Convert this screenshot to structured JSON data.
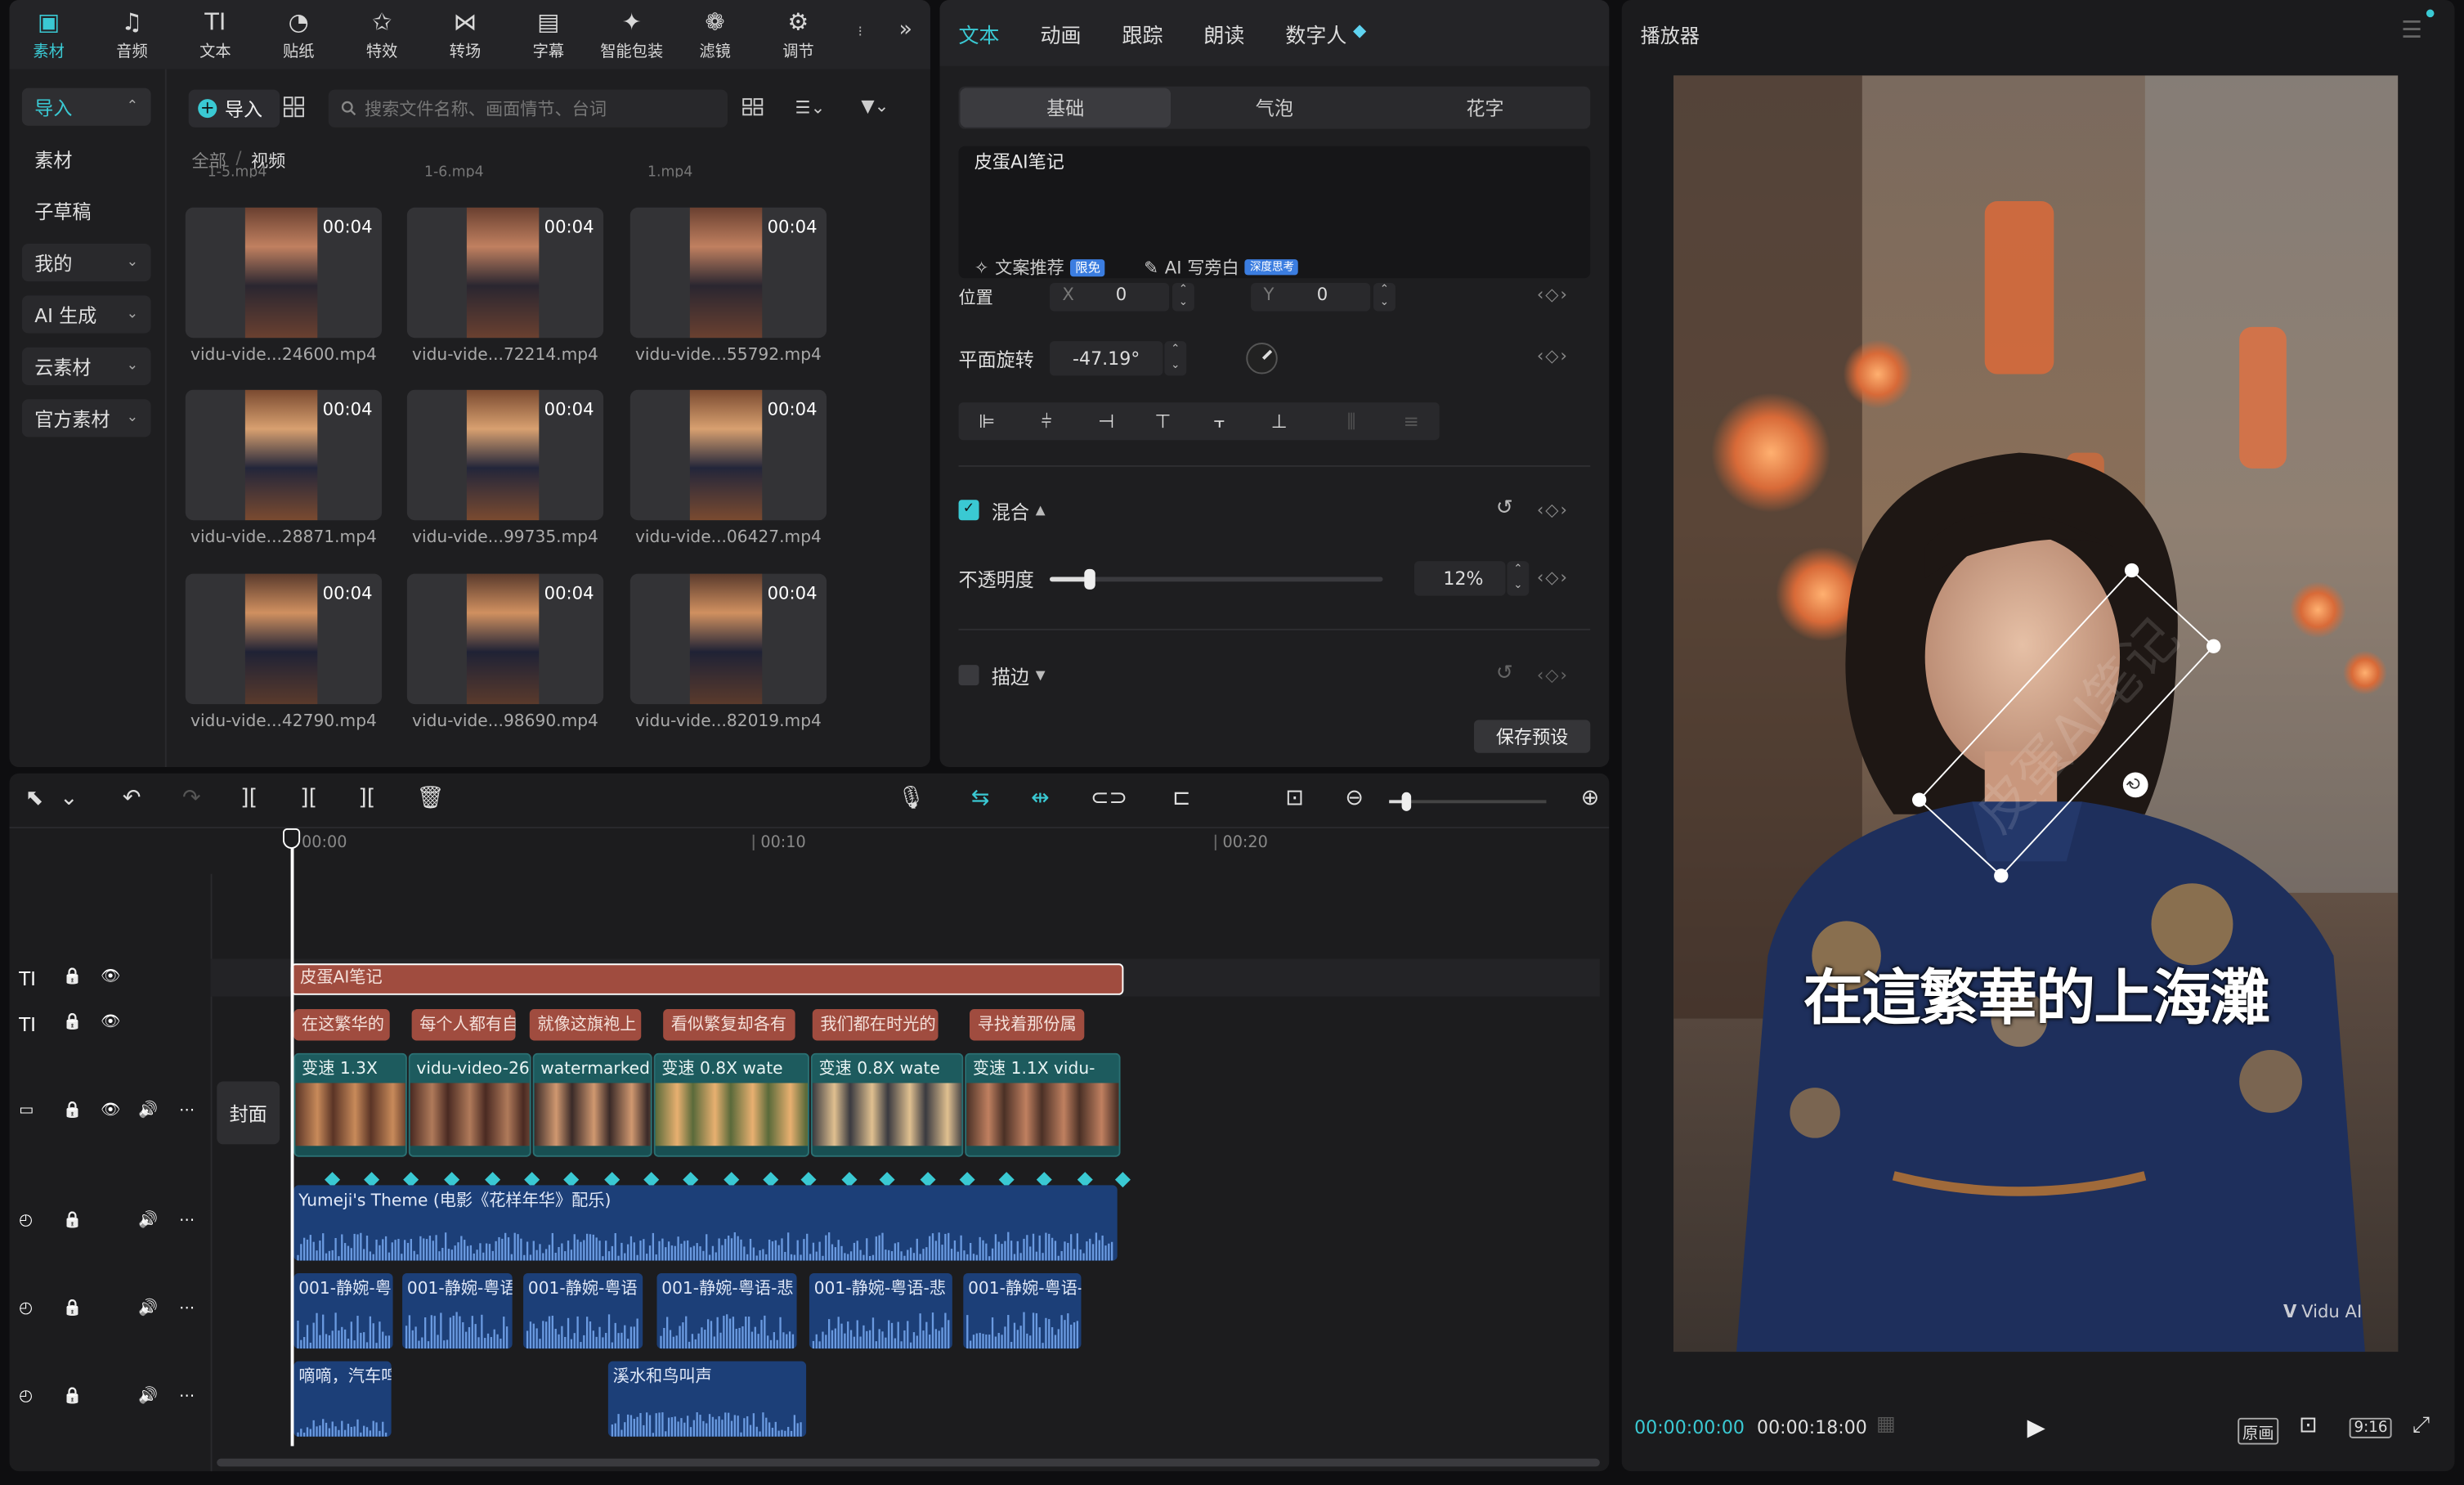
{
  "toolbar": {
    "items": [
      {
        "label": "素材",
        "icon": "media-icon",
        "active": true
      },
      {
        "label": "音频",
        "icon": "audio-icon"
      },
      {
        "label": "文本",
        "icon": "text-icon"
      },
      {
        "label": "贴纸",
        "icon": "sticker-icon"
      },
      {
        "label": "特效",
        "icon": "effects-icon"
      },
      {
        "label": "转场",
        "icon": "transition-icon"
      },
      {
        "label": "字幕",
        "icon": "subtitle-icon"
      },
      {
        "label": "智能包装",
        "icon": "smart-pack-icon"
      },
      {
        "label": "滤镜",
        "icon": "filter-icon"
      },
      {
        "label": "调节",
        "icon": "adjust-icon"
      }
    ]
  },
  "media": {
    "sidebar": [
      {
        "label": "导入",
        "arrow": "⌃",
        "active": true
      },
      {
        "label": "素材"
      },
      {
        "label": "子草稿"
      },
      {
        "label": "我的",
        "arrow": "⌄"
      },
      {
        "label": "AI 生成",
        "arrow": "⌄"
      },
      {
        "label": "云素材",
        "arrow": "⌄"
      },
      {
        "label": "官方素材",
        "arrow": "⌄"
      }
    ],
    "import_label": "导入",
    "search_placeholder": "搜索文件名称、画面情节、台词",
    "breadcrumb": {
      "root": "全部",
      "sep": "/",
      "current": "视频"
    },
    "clipped_names": [
      "1-5.mp4",
      "1-6.mp4",
      "1.mp4"
    ],
    "thumbs": [
      {
        "name": "vidu-vide...24600.mp4",
        "dur": "00:04"
      },
      {
        "name": "vidu-vide...72214.mp4",
        "dur": "00:04"
      },
      {
        "name": "vidu-vide...55792.mp4",
        "dur": "00:04"
      },
      {
        "name": "vidu-vide...28871.mp4",
        "dur": "00:04"
      },
      {
        "name": "vidu-vide...99735.mp4",
        "dur": "00:04"
      },
      {
        "name": "vidu-vide...06427.mp4",
        "dur": "00:04"
      },
      {
        "name": "vidu-vide...42790.mp4",
        "dur": "00:04"
      },
      {
        "name": "vidu-vide...98690.mp4",
        "dur": "00:04"
      },
      {
        "name": "vidu-vide...82019.mp4",
        "dur": "00:04"
      }
    ]
  },
  "text_panel": {
    "tabs": [
      "文本",
      "动画",
      "跟踪",
      "朗读",
      "数字人"
    ],
    "subtabs": [
      "基础",
      "气泡",
      "花字"
    ],
    "text_value": "皮蛋AI笔记",
    "copy_suggest": "文案推荐",
    "copy_badge": "限免",
    "ai_narration": "AI 写旁白",
    "ai_badge": "深度思考",
    "position_label": "位置",
    "x_label": "X",
    "x_value": "0",
    "y_label": "Y",
    "y_value": "0",
    "rotation_label": "平面旋转",
    "rotation_value": "-47.19°",
    "blend_label": "混合",
    "opacity_label": "不透明度",
    "opacity_value": "12%",
    "opacity_fraction": 0.12,
    "stroke_label": "描边",
    "save_preset": "保存预设"
  },
  "player": {
    "title": "播放器",
    "subtitle": "在這繁華的上海灘",
    "watermark": "Vidu AI",
    "overlay_text": "皮蛋AI笔记",
    "current_time": "00:00:00:00",
    "total_time": "00:00:18:00",
    "original_label": "原画",
    "ratio_label": "9:16"
  },
  "timeline": {
    "ruler": [
      "00:00",
      "00:10",
      "00:20"
    ],
    "cover_label": "封面",
    "title_clip": "皮蛋AI笔记",
    "subtitle_clips": [
      "在这繁华的",
      "每个人都有自",
      "就像这旗袍上",
      "看似繁复却各有",
      "我们都在时光的",
      "寻找着那份属"
    ],
    "video_clips": [
      "变速 1.3X",
      "vidu-video-26",
      "watermarked.r",
      "变速 0.8X  wate",
      "变速 0.8X  wate",
      "变速 1.1X  vidu-"
    ],
    "music_clip": "Yumeji's Theme (电影《花样年华》配乐)",
    "voice_clips": [
      "001-静婉-粤",
      "001-静婉-粤语",
      "001-静婉-粤语",
      "001-静婉-粤语-悲",
      "001-静婉-粤语-悲",
      "001-静婉-粤语-"
    ],
    "sfx_clips": [
      "嘀嘀，汽车鸣",
      "溪水和鸟叫声"
    ]
  },
  "colors": {
    "accent": "#3ac9d3",
    "clip_red": "#a04c3f",
    "video_teal": "#184f52",
    "audio_blue": "#1c3f78"
  }
}
